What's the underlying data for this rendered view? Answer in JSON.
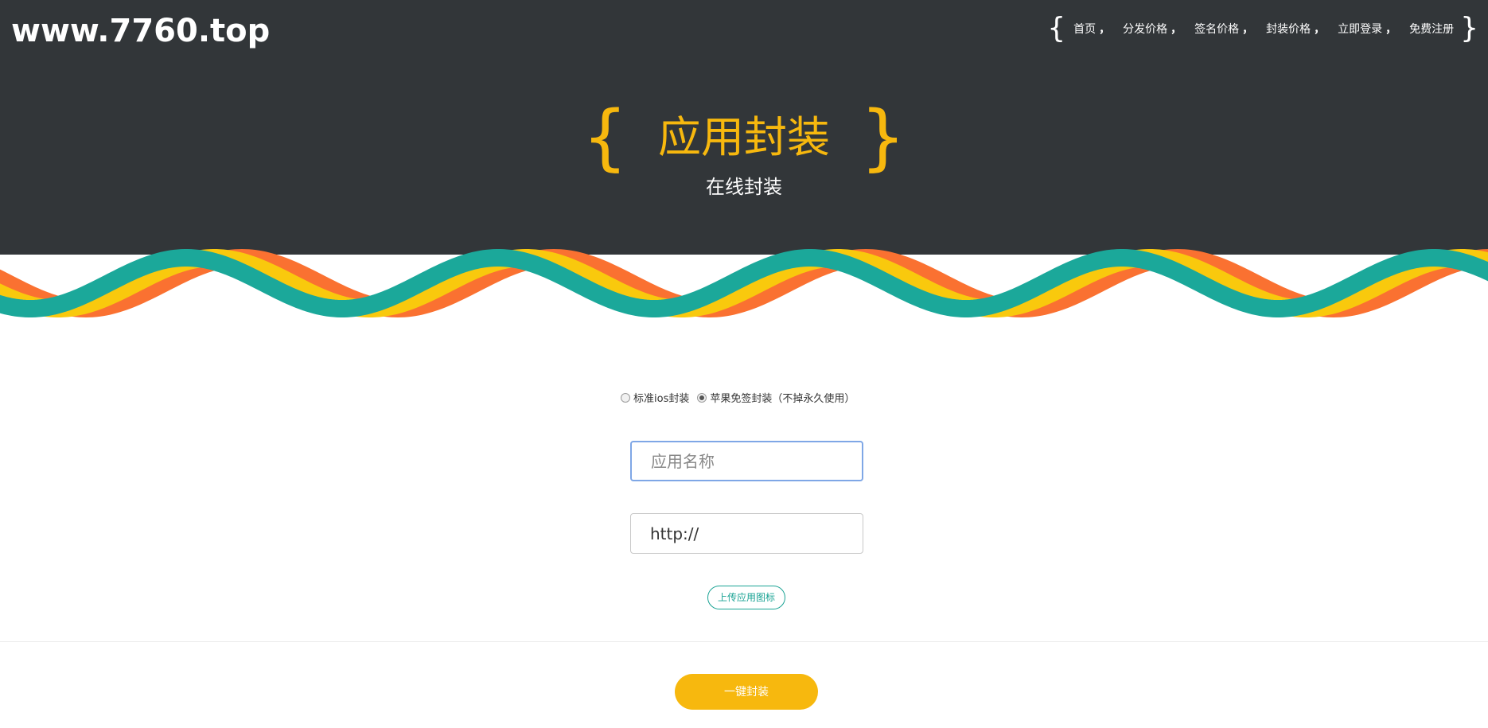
{
  "site": {
    "logo": "www.7760.top"
  },
  "nav": {
    "open_brace": "{",
    "close_brace": "}",
    "items": [
      {
        "label": "首页",
        "sep": "，"
      },
      {
        "label": "分发价格",
        "sep": "，"
      },
      {
        "label": "签名价格",
        "sep": "，"
      },
      {
        "label": "封装价格",
        "sep": "，"
      },
      {
        "label": "立即登录",
        "sep": "，"
      },
      {
        "label": "免费注册",
        "sep": ""
      }
    ]
  },
  "hero": {
    "open_brace": "{",
    "close_brace": "}",
    "title": "应用封装",
    "subtitle": "在线封装"
  },
  "form": {
    "radio_options": [
      {
        "label": "标准ios封装",
        "checked": false
      },
      {
        "label": "苹果免签封装（不掉永久使用）",
        "checked": true
      }
    ],
    "app_name": {
      "placeholder": "应用名称",
      "value": ""
    },
    "url": {
      "placeholder": "",
      "value": "http://"
    },
    "upload_label": "上传应用图标",
    "submit_label": "一键封装"
  },
  "colors": {
    "header_bg": "#323639",
    "accent_yellow": "#f7b80e",
    "wave_teal": "#1ba89a",
    "wave_yellow": "#f9c90d",
    "wave_orange": "#fa7131"
  }
}
